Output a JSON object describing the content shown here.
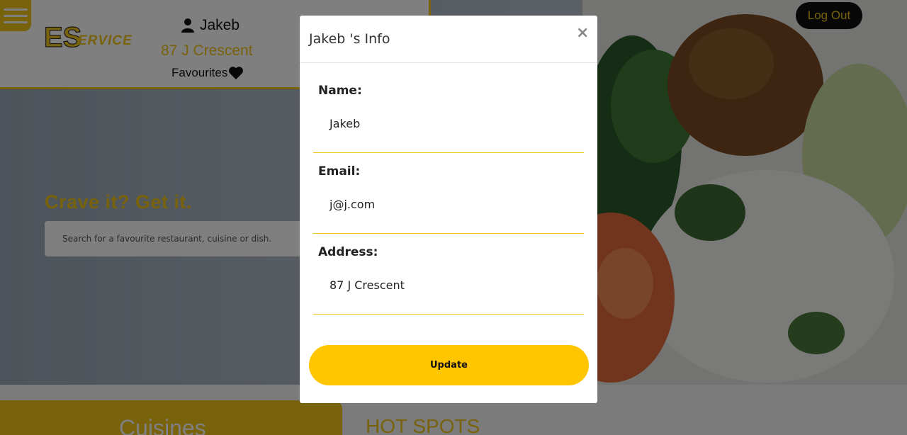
{
  "header": {
    "logo_text": "ESERVICE",
    "user_name": "Jakeb",
    "user_address": "87 J Crescent",
    "favourites_label": "Favourites"
  },
  "logout_label": "Log Out",
  "hero": {
    "tagline": "Crave it? Get it.",
    "search_placeholder": "Search for a favourite restaurant, cuisine or dish."
  },
  "sections": {
    "cuisines_label": "Cuisines",
    "hotspots_label": "HOT SPOTS"
  },
  "modal": {
    "title": "Jakeb 's Info",
    "close_symbol": "×",
    "fields": [
      {
        "label": "Name:",
        "value": "Jakeb"
      },
      {
        "label": "Email:",
        "value": "j@j.com"
      },
      {
        "label": "Address:",
        "value": "87 J Crescent"
      }
    ],
    "update_label": "Update"
  },
  "colors": {
    "brand_yellow": "#f0c419",
    "button_yellow": "#ffc600"
  },
  "icons": [
    "menu-icon",
    "user-icon",
    "heart-icon",
    "close-icon"
  ]
}
